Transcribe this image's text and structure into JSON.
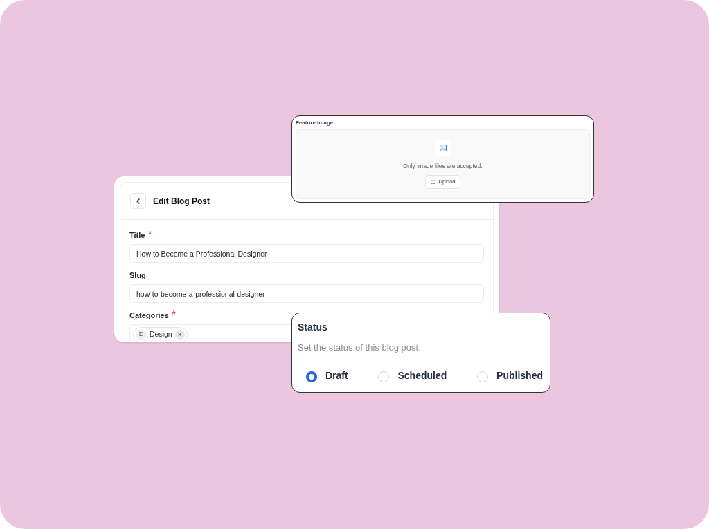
{
  "edit_post": {
    "title": "Edit Blog Post",
    "fields": [
      {
        "label": "Title",
        "required_mark": "*",
        "value": "How to Become a Professional Designer"
      },
      {
        "label": "Slug",
        "value": "how-to-become-a-professional-designer"
      }
    ],
    "categories": {
      "label": "Categories",
      "required_mark": "*",
      "tags": [
        {
          "initial": "D",
          "name": "Design",
          "remove": "×"
        }
      ]
    }
  },
  "feature_image": {
    "label": "Feature Image",
    "hint": "Only image files are accepted.",
    "button": "Upload"
  },
  "status": {
    "title": "Status",
    "description": "Set the status of this blog post.",
    "options": [
      {
        "label": "Draft",
        "selected": true
      },
      {
        "label": "Scheduled",
        "selected": false
      },
      {
        "label": "Published",
        "selected": false
      }
    ]
  }
}
